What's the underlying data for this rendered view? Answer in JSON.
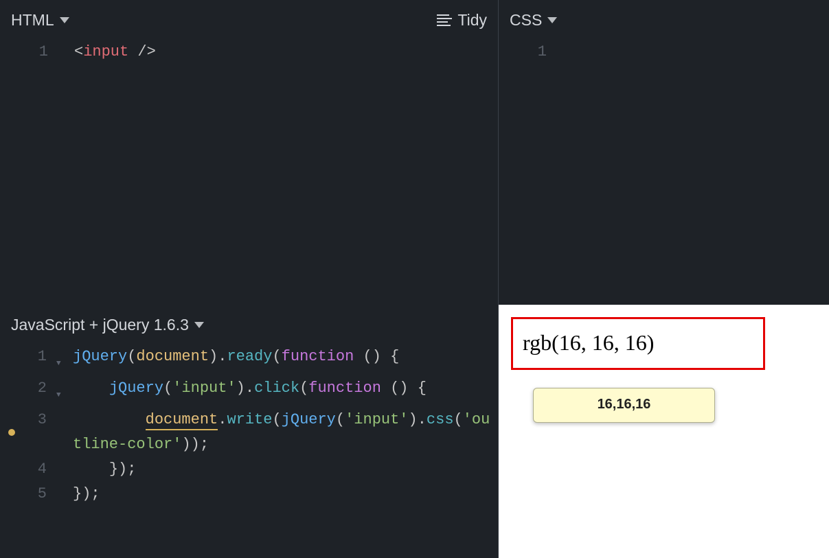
{
  "panels": {
    "html": {
      "title": "HTML",
      "tidy_label": "Tidy"
    },
    "css": {
      "title": "CSS"
    },
    "js": {
      "title": "JavaScript + jQuery 1.6.3"
    }
  },
  "html_editor": {
    "lines": [
      {
        "num": "1"
      }
    ],
    "code": {
      "open": "<",
      "tag": "input",
      "close": " />"
    }
  },
  "css_editor": {
    "lines": [
      {
        "num": "1"
      }
    ]
  },
  "js_editor": {
    "lines": [
      {
        "num": "1",
        "fold": "▼"
      },
      {
        "num": "2",
        "fold": "▼"
      },
      {
        "num": "3",
        "warn": true
      },
      {
        "num": "4"
      },
      {
        "num": "5"
      }
    ],
    "tokens": {
      "jQuery": "jQuery",
      "document": "document",
      "ready": "ready",
      "function": "function",
      "openBrace": " {",
      "inputStr": "'input'",
      "click": "click",
      "write": "write",
      "inpStr1": "'inp",
      "inpStr2": "ut'",
      "css": "css",
      "outlineStr": "'outline-color'",
      "closeInner": "    });",
      "closeOuter": "});"
    }
  },
  "output": {
    "input_value": "rgb(16, 16, 16)",
    "tooltip": "16,16,16"
  }
}
